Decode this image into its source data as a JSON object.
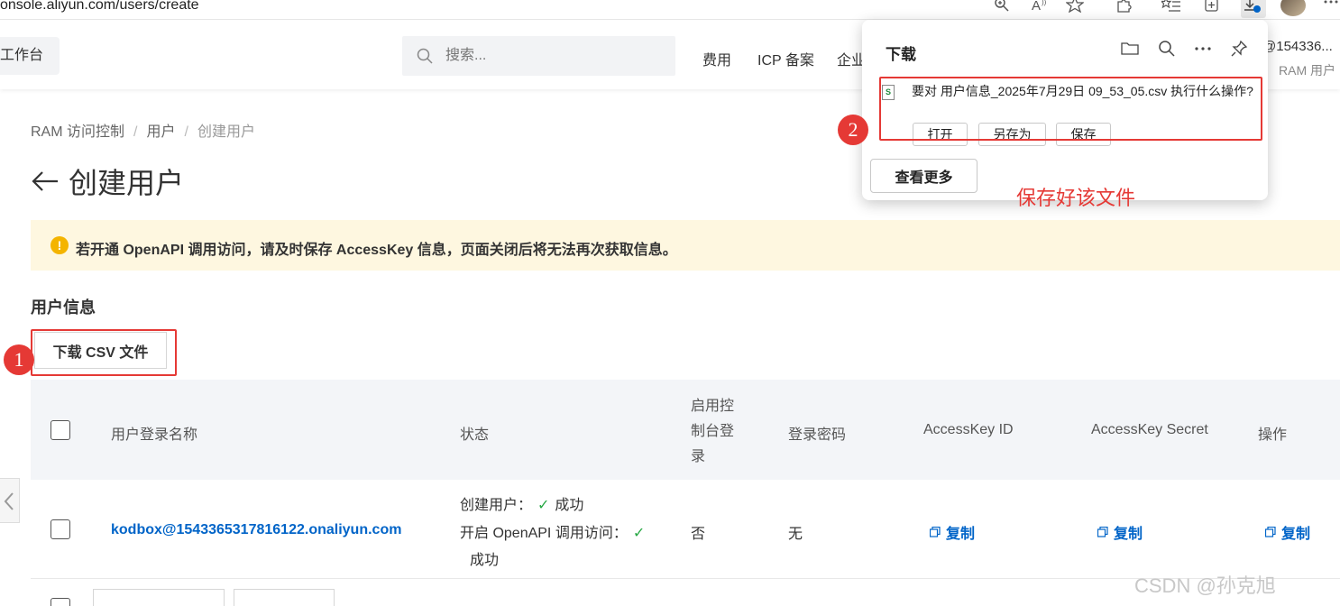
{
  "browser": {
    "url": "onsole.aliyun.com/users/create",
    "icons": [
      "zoom-icon",
      "read-aloud-icon",
      "favorite-icon",
      "extensions-icon",
      "favorites-list-icon",
      "collections-icon",
      "downloads-icon",
      "profile-avatar"
    ]
  },
  "topnav": {
    "workbench": "工作台",
    "search_placeholder": "搜索...",
    "links": [
      "费用",
      "ICP 备案",
      "企业"
    ],
    "account_name": "@154336...",
    "account_role": "RAM 用户"
  },
  "breadcrumb": [
    "RAM 访问控制",
    "用户",
    "创建用户"
  ],
  "page_title": "创建用户",
  "warning_banner": "若开通 OpenAPI 调用访问，请及时保存 AccessKey 信息，页面关闭后将无法再次获取信息。",
  "section_title": "用户信息",
  "download_csv_label": "下载 CSV 文件",
  "badges": {
    "one": "1",
    "two": "2"
  },
  "table": {
    "headers": {
      "login_name": "用户登录名称",
      "status": "状态",
      "console_login": [
        "启用控",
        "制台登",
        "录"
      ],
      "password": "登录密码",
      "ak_id": "AccessKey ID",
      "ak_secret": "AccessKey Secret",
      "actions": "操作"
    },
    "rows": [
      {
        "login_name": "kodbox@1543365317816122.onaliyun.com",
        "status_create": "创建用户：",
        "status_create_result": "成功",
        "status_openapi": "开启 OpenAPI 调用访问：",
        "status_openapi_result": "成功",
        "console_login": "否",
        "password": "无",
        "ak_id_action": "复制",
        "ak_secret_action": "复制",
        "row_action": "复制"
      }
    ]
  },
  "download_panel": {
    "title": "下载",
    "message": "要对 用户信息_2025年7月29日 09_53_05.csv 执行什么操作?",
    "buttons": [
      "打开",
      "另存为",
      "保存"
    ],
    "more": "查看更多",
    "header_icons": [
      "folder-icon",
      "search-icon",
      "more-icon",
      "pin-icon"
    ]
  },
  "annotation": "保存好该文件",
  "watermark": "CSDN @孙克旭",
  "colors": {
    "accent": "#0064c8",
    "annotation_red": "#e53935",
    "success": "#27a844",
    "warning_bg": "#fef7e0"
  }
}
